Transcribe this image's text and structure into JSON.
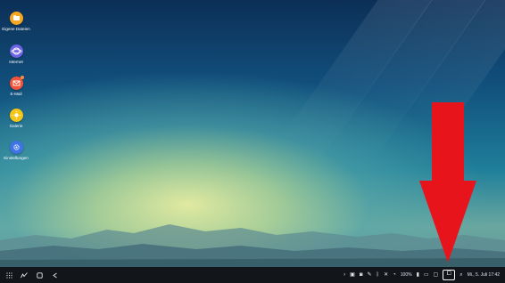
{
  "desktop": {
    "icons": [
      {
        "label": "Eigene Dateien",
        "icon": "folder-icon",
        "color": "#f5a623"
      },
      {
        "label": "Internet",
        "icon": "internet-icon",
        "color": "#6c63e6"
      },
      {
        "label": "E-Mail",
        "icon": "email-icon",
        "color": "#f0553c",
        "badge": true
      },
      {
        "label": "Galerie",
        "icon": "gallery-icon",
        "color": "#f5c518"
      },
      {
        "label": "Einstellungen",
        "icon": "settings-icon",
        "color": "#3f73e6"
      }
    ]
  },
  "taskbar": {
    "left_buttons": [
      "apps-grid-icon",
      "recent-apps-icon",
      "home-icon",
      "back-icon"
    ],
    "right": {
      "battery": "100%",
      "datetime": "Mi., 5. Juli 17:42"
    }
  },
  "annotation": {
    "color": "#e8141c"
  }
}
